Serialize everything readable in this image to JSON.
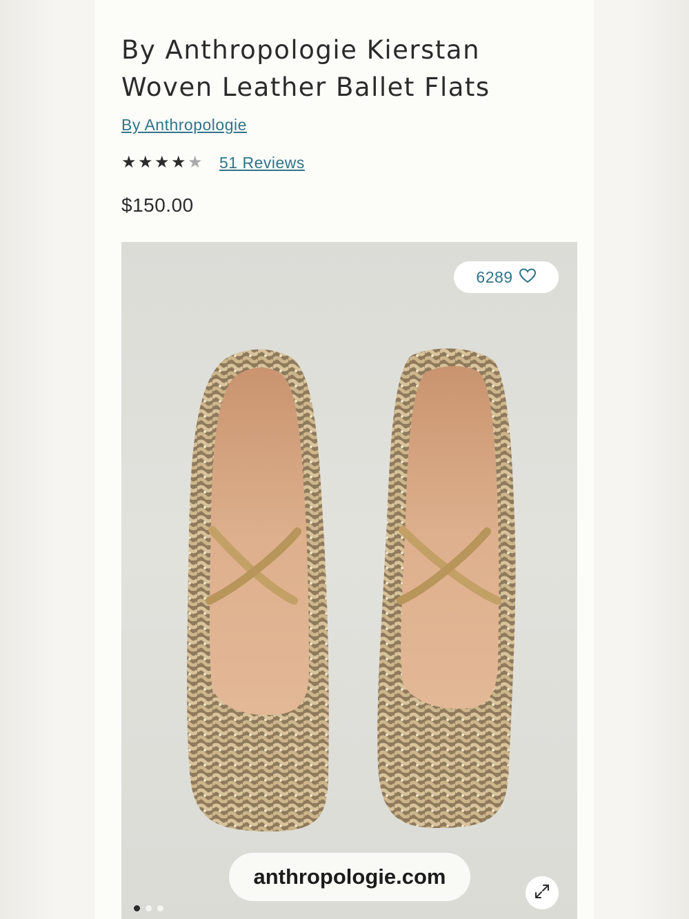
{
  "product": {
    "title": "By Anthropologie Kierstan Woven Leather Ballet Flats",
    "brand": "By Anthropologie",
    "rating": 4,
    "rating_max": 5,
    "reviews_label": "51 Reviews",
    "price": "$150.00"
  },
  "gallery": {
    "favorite_count": "6289",
    "watermark": "anthropologie.com",
    "slide_count": 3,
    "active_slide": 1,
    "image_alt": "Woven metallic leather ballet flats with crossed elastic straps"
  },
  "icons": {
    "favorite": "heart-icon",
    "expand": "expand-icon",
    "star": "star-icon"
  },
  "colors": {
    "link": "#2f7489",
    "text": "#2b2b2b",
    "shoe_gold": "#c9b189",
    "lining": "#d9ab88",
    "strap": "#c7a66a"
  }
}
